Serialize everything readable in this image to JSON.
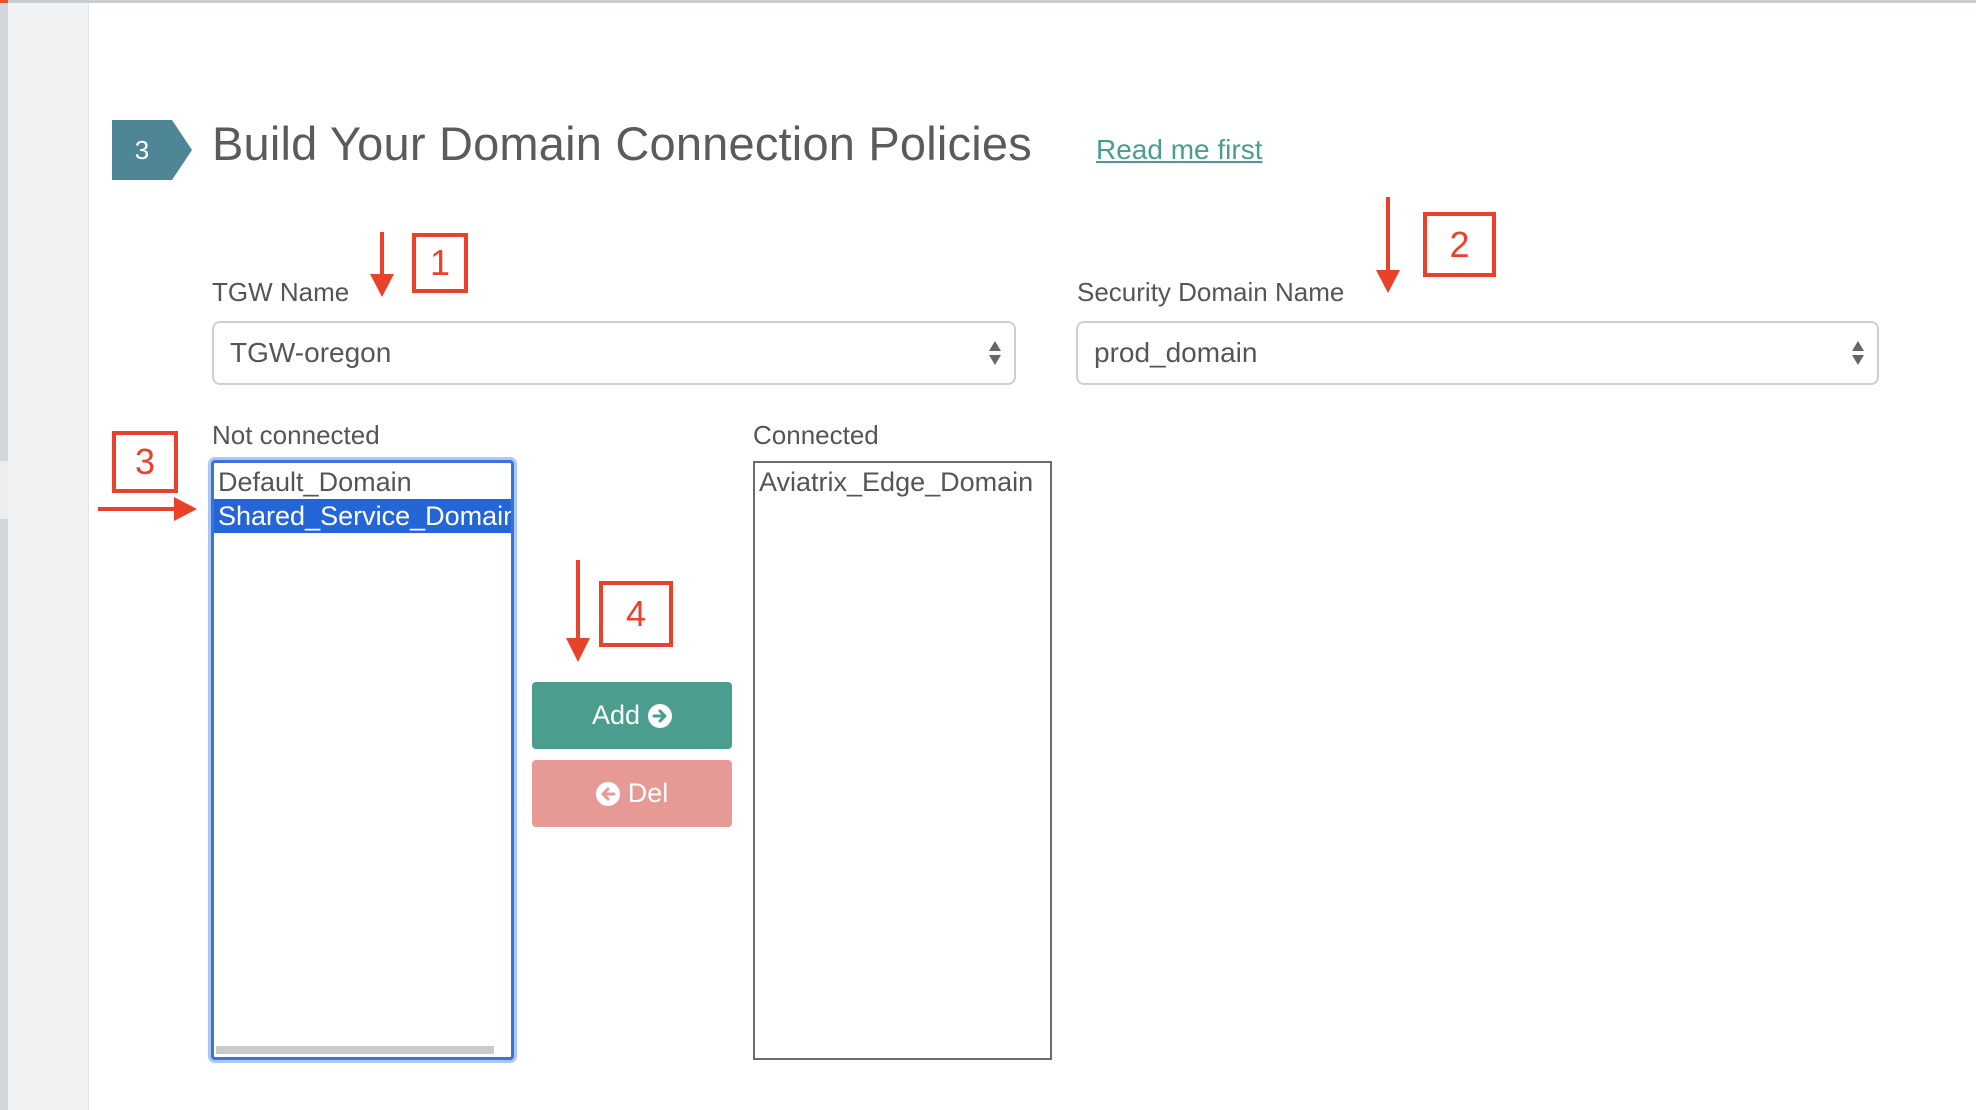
{
  "step": {
    "number": "3",
    "title": "Build Your Domain Connection Policies",
    "link_label": "Read me first"
  },
  "tgw": {
    "label": "TGW Name",
    "value": "TGW-oregon"
  },
  "security_domain": {
    "label": "Security Domain Name",
    "value": "prod_domain"
  },
  "not_connected": {
    "label": "Not connected",
    "items": [
      {
        "label": "Default_Domain",
        "selected": false
      },
      {
        "label": "Shared_Service_Domain",
        "selected": true
      }
    ]
  },
  "connected": {
    "label": "Connected",
    "items": [
      {
        "label": "Aviatrix_Edge_Domain",
        "selected": false
      }
    ]
  },
  "buttons": {
    "add_label": "Add",
    "del_label": "Del"
  },
  "annotations": {
    "step1": "1",
    "step2": "2",
    "step3": "3",
    "step4": "4"
  },
  "colors": {
    "badge": "#4e8696",
    "link": "#4a9d91",
    "add_button": "#4a9d8f",
    "del_button": "#e69995",
    "selection": "#2465d8",
    "annotation": "#e8432a"
  }
}
